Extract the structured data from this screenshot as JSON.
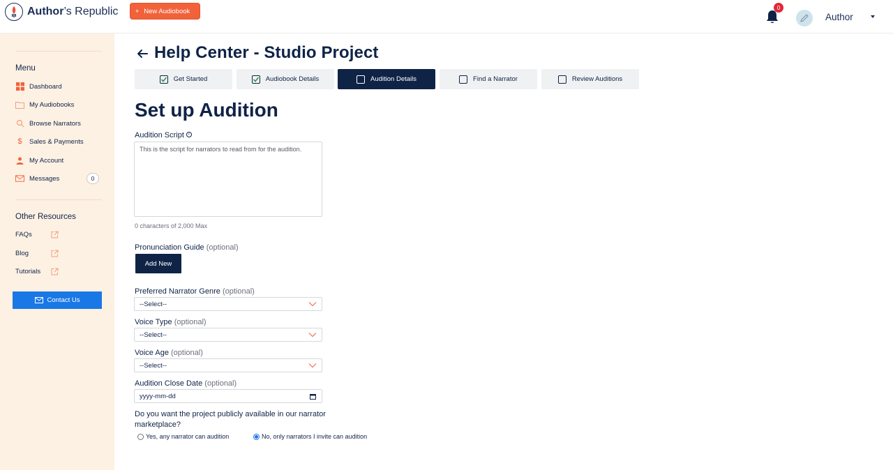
{
  "app": {
    "logo_text_prefix": "Author",
    "logo_text_suffix": "’s Republic",
    "new_button_label": "New Audiobook",
    "notification_count": "0",
    "user_name": "Author"
  },
  "sidebar": {
    "menu_heading": "Menu",
    "menu_items": [
      {
        "label": "Dashboard",
        "icon": "dashboard-grid-icon"
      },
      {
        "label": "My Audiobooks",
        "icon": "folder-icon"
      },
      {
        "label": "Browse Narrators",
        "icon": "search-icon"
      },
      {
        "label": "Sales & Payments",
        "icon": "dollar-icon"
      },
      {
        "label": "My Account",
        "icon": "user-icon"
      },
      {
        "label": "Messages",
        "icon": "envelope-icon",
        "badge": "0"
      }
    ],
    "resources_heading": "Other Resources",
    "resource_items": [
      {
        "label": "FAQs",
        "icon": "external-link-icon"
      },
      {
        "label": "Blog",
        "icon": "external-link-icon"
      },
      {
        "label": "Tutorials",
        "icon": "external-link-icon"
      }
    ],
    "contact_label": "Contact Us"
  },
  "page": {
    "title": "Help Center - Studio Project",
    "steps": [
      {
        "label": "Get Started",
        "checked": true,
        "active": false
      },
      {
        "label": "Audiobook Details",
        "checked": true,
        "active": false
      },
      {
        "label": "Audition Details",
        "checked": false,
        "active": true
      },
      {
        "label": "Find a Narrator",
        "checked": false,
        "active": false
      },
      {
        "label": "Review Auditions",
        "checked": false,
        "active": false
      }
    ],
    "section_title": "Set up Audition"
  },
  "form": {
    "script_label": "Audition Script",
    "script_placeholder": "This is the script for narrators to read from for the audition.",
    "char_count": "0 characters of 2,000 Max",
    "pronunciation_label": "Pronunciation Guide",
    "optional_text": "(optional)",
    "add_new_label": "Add New",
    "genre_label": "Preferred Narrator Genre",
    "genre_value": "--Select--",
    "voice_type_label": "Voice Type",
    "voice_type_value": "--Select--",
    "voice_age_label": "Voice Age",
    "voice_age_value": "--Select--",
    "close_date_label": "Audition Close Date",
    "close_date_placeholder": "yyyy-mm-dd",
    "public_question": "Do you want the project publicly available in our narrator marketplace?",
    "radio_yes": "Yes, any narrator can audition",
    "radio_no": "No, only narrators I invite can audition",
    "selected_option": "radio_no"
  },
  "colors": {
    "navy": "#0f2347",
    "brand_orange": "#f2623a",
    "sidebar_bg": "#fdf1e4",
    "contact_blue": "#1a78e6",
    "checkbox_green": "#2f9a4a"
  }
}
